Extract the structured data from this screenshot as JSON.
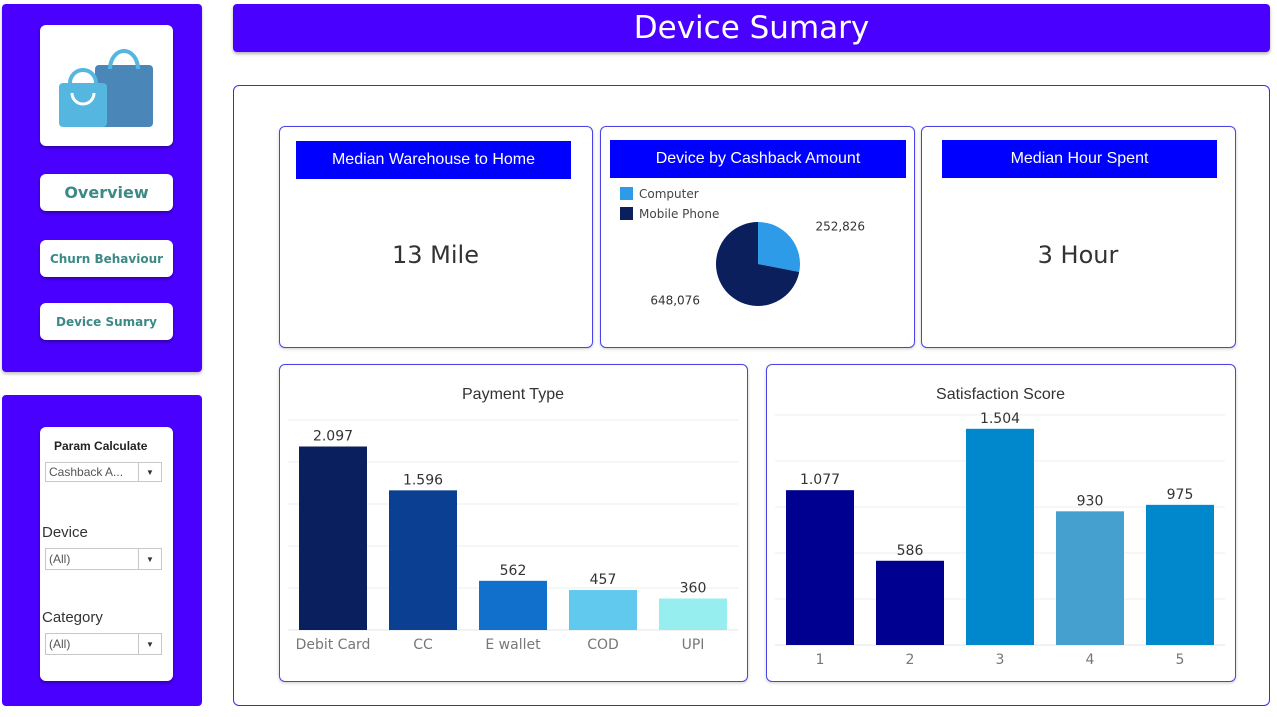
{
  "app": {
    "title": "Device Sumary"
  },
  "nav": {
    "logo_icon": "shopping-bags-icon",
    "overview_label": "Overview",
    "churn_label": "Churn Behaviour",
    "device_label": "Device Sumary"
  },
  "filters": {
    "param_title": "Param Calculate",
    "param_value": "Cashback A...",
    "device_label": "Device",
    "device_value": "(All)",
    "category_label": "Category",
    "category_value": "(All)"
  },
  "kpis": {
    "warehouse_title": "Median Warehouse to Home",
    "warehouse_value": "13 Mile",
    "hour_title": "Median Hour Spent",
    "hour_value": "3 Hour"
  },
  "colors": {
    "brand": "#4a00ff",
    "header_blue": "#0000ff",
    "nav_text": "#3b8a86"
  },
  "chart_data": [
    {
      "type": "pie",
      "title": "Device by  Cashback Amount",
      "categories": [
        "Computer",
        "Mobile Phone"
      ],
      "values": [
        252826,
        648076
      ],
      "labels": [
        "252,826",
        "648,076"
      ],
      "colors": [
        "#2e9be8",
        "#0b1f5c"
      ],
      "legend": "top-left"
    },
    {
      "type": "bar",
      "title": "Payment Type",
      "categories": [
        "Debit Card",
        "CC",
        "E wallet",
        "COD",
        "UPI"
      ],
      "values": [
        2097,
        1596,
        562,
        457,
        360
      ],
      "labels": [
        "2.097",
        "1.596",
        "562",
        "457",
        "360"
      ],
      "colors": [
        "#0a1f5e",
        "#0a3f92",
        "#1170cc",
        "#62c9ee",
        "#97eeee"
      ],
      "ylim": [
        0,
        2400
      ],
      "grid": true
    },
    {
      "type": "bar",
      "title": "Satisfaction Score",
      "categories": [
        "1",
        "2",
        "3",
        "4",
        "5"
      ],
      "values": [
        1077,
        586,
        1504,
        930,
        975
      ],
      "labels": [
        "1.077",
        "586",
        "1.504",
        "930",
        "975"
      ],
      "colors": [
        "#000090",
        "#000090",
        "#0087cc",
        "#46a0cf",
        "#0087cc"
      ],
      "ylim": [
        0,
        1600
      ],
      "grid": true
    }
  ]
}
